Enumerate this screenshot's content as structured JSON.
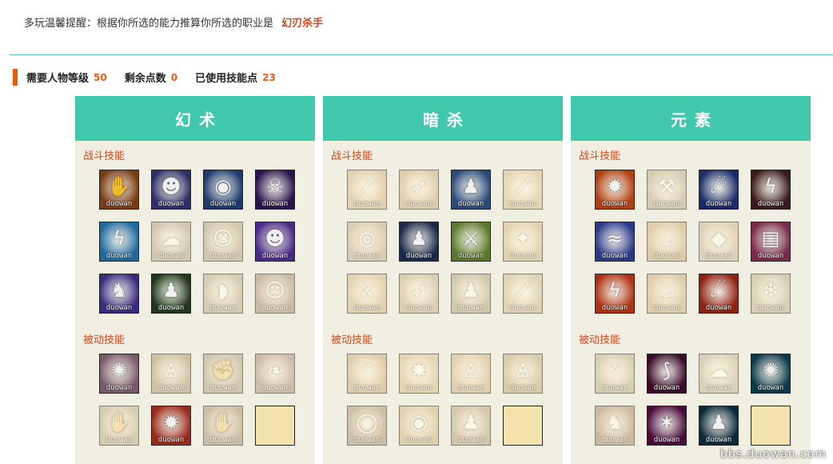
{
  "tip": {
    "text": "多玩温馨提醒：根据你所选的能力推算你所选的职业是",
    "job": "幻刃杀手"
  },
  "stats": {
    "level_label": "需要人物等级",
    "level": "50",
    "remaining_label": "剩余点数",
    "remaining": "0",
    "used_label": "已使用技能点",
    "used": "23"
  },
  "watermark": "bbs.duowan.com",
  "panels": [
    {
      "title": "幻术",
      "combat_label": "战斗技能",
      "passive_label": "被动技能",
      "combat": [
        {
          "icon": "hand",
          "bg": "#7a3a12",
          "wm": "duowan",
          "active": true
        },
        {
          "icon": "dark-head",
          "bg": "#2c2f6a",
          "wm": "duowan",
          "active": true
        },
        {
          "icon": "planet",
          "bg": "#1b3a6e",
          "wm": "duowan",
          "active": true
        },
        {
          "icon": "demon-face",
          "bg": "#2a1450",
          "wm": "duowan",
          "active": true
        },
        {
          "icon": "lightning-head",
          "bg": "#1e6aa0",
          "wm": "duowan",
          "active": true
        },
        {
          "icon": "ghost",
          "bg": "#9a9280",
          "wm": "duowan",
          "active": false
        },
        {
          "icon": "glow-head",
          "bg": "#9c9375",
          "wm": "duowan",
          "active": false
        },
        {
          "icon": "purple-head",
          "bg": "#4a2a8a",
          "wm": "duowan",
          "active": true
        },
        {
          "icon": "beast",
          "bg": "#3a2a80",
          "wm": "duowan",
          "active": true
        },
        {
          "icon": "green-figure",
          "bg": "#1f3a1a",
          "wm": "duowan",
          "active": true
        },
        {
          "icon": "shell",
          "bg": "#a09a80",
          "wm": "duowan",
          "active": false
        },
        {
          "icon": "monster",
          "bg": "#a07a60",
          "wm": "duowan",
          "active": false
        }
      ],
      "passive": [
        {
          "icon": "spiral",
          "bg": "#7a5a6a",
          "wm": "duowan",
          "active": true
        },
        {
          "icon": "monk",
          "bg": "#a48a50",
          "wm": "duowan",
          "active": false
        },
        {
          "icon": "fist",
          "bg": "#9a9270",
          "wm": "duowan",
          "active": false
        },
        {
          "icon": "curl",
          "bg": "#a07a7a",
          "wm": "duowan",
          "active": false
        },
        {
          "icon": "claw",
          "bg": "#a59a7a",
          "wm": "duowan",
          "active": false
        },
        {
          "icon": "explosion",
          "bg": "#9a2a1a",
          "wm": "duowan",
          "active": true
        },
        {
          "icon": "grab",
          "bg": "#a0805a",
          "wm": "duowan",
          "active": false
        },
        {
          "icon": "",
          "bg": "",
          "wm": "",
          "active": false,
          "empty": true
        }
      ]
    },
    {
      "title": "暗杀",
      "combat_label": "战斗技能",
      "passive_label": "被动技能",
      "combat": [
        {
          "icon": "slash",
          "bg": "#c4a060",
          "wm": "duowan",
          "active": false
        },
        {
          "icon": "dash",
          "bg": "#c49a58",
          "wm": "duowan",
          "active": false
        },
        {
          "icon": "assassin",
          "bg": "#2a4a7a",
          "wm": "duowan",
          "active": true
        },
        {
          "icon": "blade",
          "bg": "#c4a868",
          "wm": "duowan",
          "active": false
        },
        {
          "icon": "target",
          "bg": "#b49878",
          "wm": "duowan",
          "active": false
        },
        {
          "icon": "shadow",
          "bg": "#1a2a4a",
          "wm": "duowan",
          "active": true
        },
        {
          "icon": "green-blade",
          "bg": "#5a7a2a",
          "wm": "duowan",
          "active": true
        },
        {
          "icon": "strike",
          "bg": "#c4a45a",
          "wm": "duowan",
          "active": false
        },
        {
          "icon": "sword",
          "bg": "#c4a460",
          "wm": "duowan",
          "active": false
        },
        {
          "icon": "rush",
          "bg": "#aca080",
          "wm": "duowan",
          "active": false
        },
        {
          "icon": "figure",
          "bg": "#9a9478",
          "wm": "duowan",
          "active": false
        },
        {
          "icon": "cut",
          "bg": "#aca878",
          "wm": "duowan",
          "active": false
        }
      ],
      "passive": [
        {
          "icon": "arc",
          "bg": "#c49a58",
          "wm": "duowan",
          "active": false
        },
        {
          "icon": "burst",
          "bg": "#c4a868",
          "wm": "duowan",
          "active": false
        },
        {
          "icon": "arm",
          "bg": "#c4a060",
          "wm": "duowan",
          "active": false
        },
        {
          "icon": "body",
          "bg": "#b4985a",
          "wm": "duowan",
          "active": false
        },
        {
          "icon": "ring",
          "bg": "#a48060",
          "wm": "duowan",
          "active": false
        },
        {
          "icon": "eye",
          "bg": "#c4a058",
          "wm": "duowan",
          "active": false
        },
        {
          "icon": "pose",
          "bg": "#a4906a",
          "wm": "duowan",
          "active": false
        },
        {
          "icon": "",
          "bg": "",
          "wm": "",
          "active": false,
          "empty": true
        }
      ]
    },
    {
      "title": "元素",
      "combat_label": "战斗技能",
      "passive_label": "被动技能",
      "combat": [
        {
          "icon": "fireball",
          "bg": "#b04010",
          "wm": "duowan",
          "active": true
        },
        {
          "icon": "shovel",
          "bg": "#a49a7a",
          "wm": "duowan",
          "active": false
        },
        {
          "icon": "comet",
          "bg": "#1a2a6a",
          "wm": "duowan",
          "active": true
        },
        {
          "icon": "red-lightning",
          "bg": "#3a1a1a",
          "wm": "duowan",
          "active": true
        },
        {
          "icon": "blue-wave",
          "bg": "#2a3a8a",
          "wm": "duowan",
          "active": true
        },
        {
          "icon": "flame",
          "bg": "#c4984a",
          "wm": "duowan",
          "active": false
        },
        {
          "icon": "rock",
          "bg": "#aca488",
          "wm": "duowan",
          "active": false
        },
        {
          "icon": "scroll",
          "bg": "#7a2a4a",
          "wm": "duowan",
          "active": true
        },
        {
          "icon": "fire-bolt",
          "bg": "#b03010",
          "wm": "duowan",
          "active": true
        },
        {
          "icon": "blaze",
          "bg": "#c49a50",
          "wm": "duowan",
          "active": false
        },
        {
          "icon": "meteor",
          "bg": "#902010",
          "wm": "duowan",
          "active": true
        },
        {
          "icon": "ice",
          "bg": "#9aa080",
          "wm": "duowan",
          "active": false
        }
      ],
      "passive": [
        {
          "icon": "aura",
          "bg": "#a4a078",
          "wm": "duowan",
          "active": false
        },
        {
          "icon": "pink-slash",
          "bg": "#3a0a2a",
          "wm": "duowan",
          "active": true
        },
        {
          "icon": "mist",
          "bg": "#a4a48a",
          "wm": "duowan",
          "active": false
        },
        {
          "icon": "vortex",
          "bg": "#0a3a4a",
          "wm": "duowan",
          "active": true
        },
        {
          "icon": "warrior",
          "bg": "#b07050",
          "wm": "duowan",
          "active": false
        },
        {
          "icon": "pink-star",
          "bg": "#4a0a3a",
          "wm": "duowan",
          "active": true
        },
        {
          "icon": "ice-mage",
          "bg": "#0a2a3a",
          "wm": "duowan",
          "active": true
        },
        {
          "icon": "",
          "bg": "",
          "wm": "",
          "active": false,
          "empty": true
        }
      ]
    }
  ]
}
